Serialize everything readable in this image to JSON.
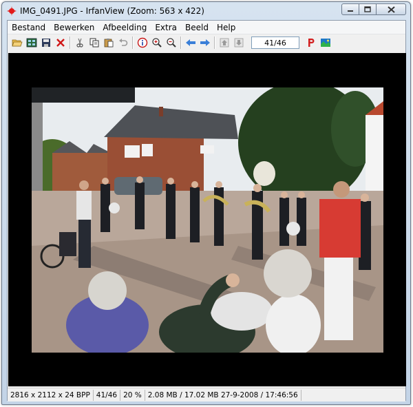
{
  "window": {
    "title": "IMG_0491.JPG - IrfanView (Zoom: 563 x 422)"
  },
  "menu": [
    "Bestand",
    "Bewerken",
    "Afbeelding",
    "Extra",
    "Beeld",
    "Help"
  ],
  "toolbar": {
    "page_counter": "41/46",
    "icons": [
      "open-folder",
      "thumbnails",
      "save",
      "delete",
      "cut",
      "copy",
      "paste",
      "undo",
      "info",
      "zoom-in",
      "zoom-out",
      "previous",
      "next",
      "first",
      "last",
      "print",
      "settings"
    ]
  },
  "status": {
    "dimensions": "2816 x 2112 x 24 BPP",
    "index": "41/46",
    "zoom": "20 %",
    "file_info": "2.08 MB / 17.02 MB 27-9-2008 / 17:46:56"
  },
  "colors": {
    "viewer_bg": "#000000",
    "title_bar": "#c8d8ea",
    "accent_blue": "#3a7fd8",
    "print_red": "#d21e1e"
  }
}
